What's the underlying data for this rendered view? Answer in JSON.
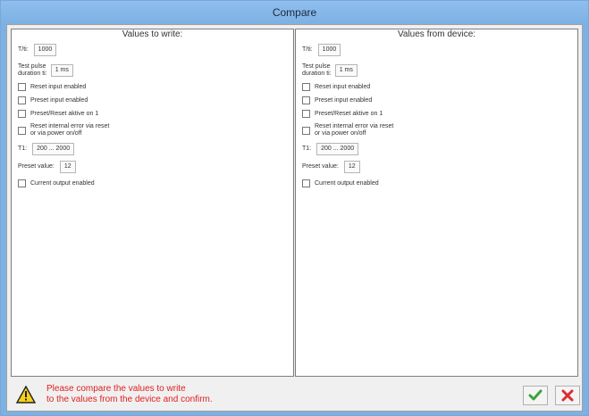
{
  "window": {
    "title": "Compare"
  },
  "left": {
    "header": "Values to write:",
    "ta_label": "T/ti:",
    "ta_value": "1000",
    "pulse_label_1": "Test pulse",
    "pulse_label_2": "duration ti:",
    "pulse_value": "1 ms",
    "reset_input": "Reset input enabled",
    "preset_input": "Preset input enabled",
    "preset_reset": "Preset/Reset aktive on 1",
    "reset_internal_1": "Reset internal error via reset",
    "reset_internal_2": "or via power on/off",
    "t1_label": "T1:",
    "t1_value": "200 ... 2000",
    "preset_value_label": "Preset value:",
    "preset_value": "12",
    "current_output": "Current output enabled"
  },
  "right": {
    "header": "Values from device:",
    "ta_label": "T/ti:",
    "ta_value": "1000",
    "pulse_label_1": "Test pulse",
    "pulse_label_2": "duration ti:",
    "pulse_value": "1 ms",
    "reset_input": "Reset input enabled",
    "preset_input": "Preset input enabled",
    "preset_reset": "Preset/Reset aktive on 1",
    "reset_internal_1": "Reset internal error via reset",
    "reset_internal_2": "or via power on/off",
    "t1_label": "T1:",
    "t1_value": "200 ... 2000",
    "preset_value_label": "Preset value:",
    "preset_value": "12",
    "current_output": "Current output enabled"
  },
  "footer": {
    "message_line1": "Please compare the values to write",
    "message_line2": "to the values from the device and confirm.",
    "warning_icon": "warning-triangle-icon",
    "confirm_icon": "checkmark-icon",
    "cancel_icon": "close-x-icon"
  },
  "colors": {
    "message": "#e02020",
    "confirm": "#3ca33c",
    "cancel": "#d83030"
  }
}
